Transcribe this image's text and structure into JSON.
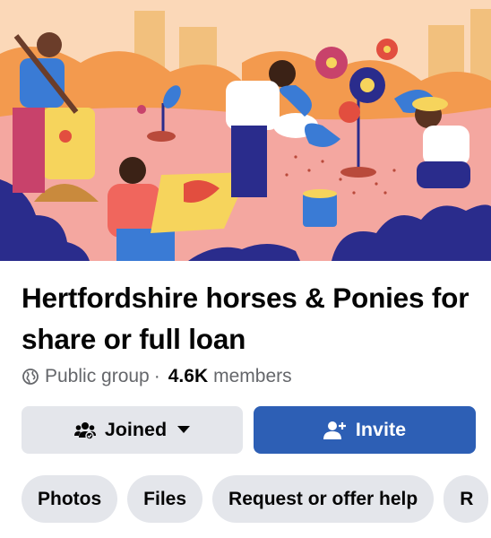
{
  "group": {
    "title": "Hertfordshire horses & Ponies for share or full loan",
    "privacy": "Public group",
    "separator": "·",
    "member_count": "4.6K",
    "members_label": "members"
  },
  "actions": {
    "joined_label": "Joined",
    "invite_label": "Invite"
  },
  "tabs": [
    {
      "label": "Photos"
    },
    {
      "label": "Files"
    },
    {
      "label": "Request or offer help"
    },
    {
      "label": "R"
    }
  ],
  "colors": {
    "primary_blue": "#2d5fb5",
    "button_grey": "#e4e6eb",
    "secondary_text": "#65676b",
    "cover_pink": "#f7b99f",
    "cover_navy": "#2a2c8c"
  },
  "icons": {
    "privacy": "globe-icon",
    "joined": "group-people-icon",
    "dropdown": "caret-down-icon",
    "invite": "add-person-icon"
  }
}
